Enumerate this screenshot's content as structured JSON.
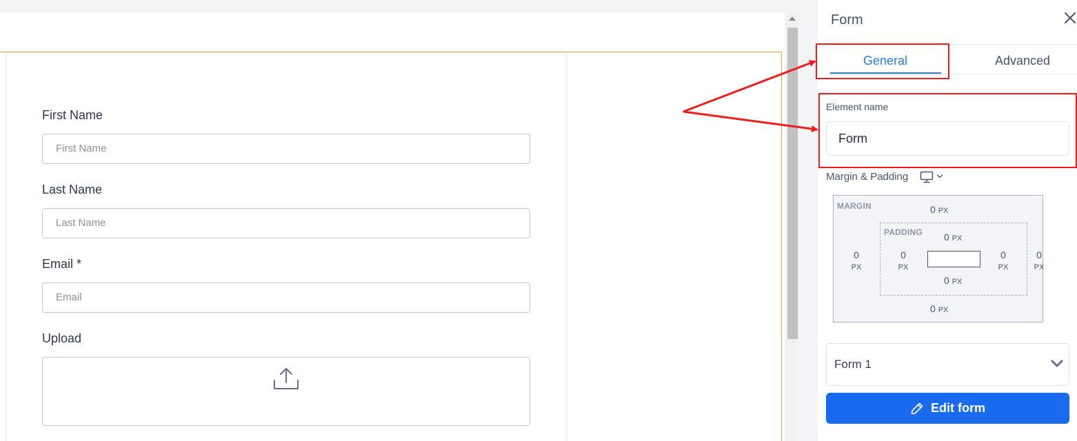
{
  "form_preview": {
    "fields": [
      {
        "label": "First Name",
        "placeholder": "First Name"
      },
      {
        "label": "Last Name",
        "placeholder": "Last Name"
      },
      {
        "label": "Email *",
        "placeholder": "Email"
      }
    ],
    "upload_label": "Upload",
    "upload_icon": "upload-icon"
  },
  "panel": {
    "title": "Form",
    "close_icon": "close-icon",
    "tabs": [
      {
        "label": "General",
        "active": true
      },
      {
        "label": "Advanced",
        "active": false
      }
    ],
    "element_name_label": "Element name",
    "element_name_value": "Form",
    "margin_padding_label": "Margin & Padding",
    "device_icon": "monitor-icon",
    "margin": {
      "tag": "MARGIN",
      "top": "0",
      "right": "0",
      "bottom": "0",
      "left": "0",
      "unit": "PX"
    },
    "padding": {
      "tag": "PADDING",
      "top": "0",
      "right": "0",
      "bottom": "0",
      "left": "0",
      "unit": "PX"
    },
    "form_select_value": "Form 1",
    "edit_button_label": "Edit form",
    "edit_icon": "pencil-icon"
  },
  "colors": {
    "accent": "#2b7de9",
    "button": "#1a6aef",
    "annotation": "#ee1c1c",
    "section_outline": "#e0a040"
  }
}
